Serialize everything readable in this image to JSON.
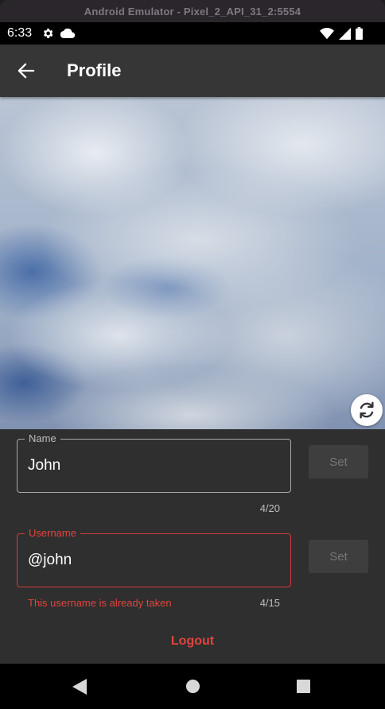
{
  "emulator": {
    "title": "Android Emulator - Pixel_2_API_31_2:5554"
  },
  "status_bar": {
    "time": "6:33",
    "left_icons": [
      "gear-icon",
      "cloud-icon"
    ],
    "right_icons": [
      "wifi-icon",
      "signal-icon",
      "battery-icon"
    ]
  },
  "app_bar": {
    "title": "Profile",
    "back_icon": "arrow-back-icon"
  },
  "hero": {
    "image": "cloudy-sky-photo",
    "action_icon": "refresh-icon"
  },
  "form": {
    "name": {
      "label": "Name",
      "value": "John",
      "counter": "4/20",
      "button_label": "Set"
    },
    "username": {
      "label": "Username",
      "value": "@john",
      "error": "This username is already taken",
      "counter": "4/15",
      "button_label": "Set"
    },
    "logout_label": "Logout"
  },
  "nav_bar": {
    "icons": [
      "back-triangle-icon",
      "home-circle-icon",
      "recents-square-icon"
    ]
  },
  "colors": {
    "error": "#e0443e",
    "app_bar": "#363636",
    "surface": "#2f2f2f"
  }
}
